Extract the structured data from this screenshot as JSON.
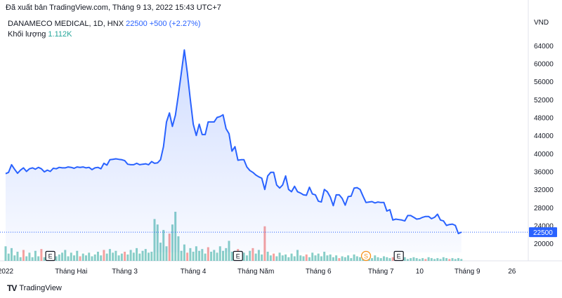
{
  "header": {
    "published": "Đã xuất bản TradingView.com, Tháng 9 13, 2022 15:43 UTC+7"
  },
  "legend": {
    "symbol": "DANAMECO MEDICAL, 1D, HNX",
    "price": "22500",
    "change": "+500 (+2.27%)",
    "volume_label": "Khối lượng",
    "volume_value": "1.112K"
  },
  "footer": {
    "brand": "TradingView",
    "logo": "TV"
  },
  "colors": {
    "line": "#2962ff",
    "fill": "#2962ff",
    "vol_up": "#26a69a",
    "vol_down": "#ef5350"
  },
  "chart_data": {
    "type": "area",
    "unit": "VND",
    "ylim": [
      18000,
      66000
    ],
    "yticks": [
      20000,
      24000,
      28000,
      32000,
      36000,
      40000,
      44000,
      48000,
      52000,
      56000,
      60000,
      64000
    ],
    "last_price": 22500,
    "xlim": [
      0,
      168
    ],
    "xticks": [
      {
        "x": 0,
        "label": "2022"
      },
      {
        "x": 22,
        "label": "Tháng Hai"
      },
      {
        "x": 40,
        "label": "Tháng 3"
      },
      {
        "x": 63,
        "label": "Tháng 4"
      },
      {
        "x": 84,
        "label": "Tháng Năm"
      },
      {
        "x": 105,
        "label": "Tháng 6"
      },
      {
        "x": 126,
        "label": "Tháng 7"
      },
      {
        "x": 139,
        "label": "10"
      },
      {
        "x": 155,
        "label": "Tháng 9"
      },
      {
        "x": 170,
        "label": "26"
      }
    ],
    "events": [
      {
        "x": 15,
        "label": "E"
      },
      {
        "x": 78,
        "label": "E"
      },
      {
        "x": 121,
        "label": "S"
      },
      {
        "x": 132,
        "label": "E"
      }
    ],
    "series": [
      {
        "values": [
          [
            0,
            35500
          ],
          [
            1,
            35800
          ],
          [
            2,
            37500
          ],
          [
            3,
            36500
          ],
          [
            4,
            35600
          ],
          [
            5,
            36300
          ],
          [
            6,
            36800
          ],
          [
            7,
            36000
          ],
          [
            8,
            36600
          ],
          [
            9,
            36800
          ],
          [
            10,
            36500
          ],
          [
            11,
            36900
          ],
          [
            12,
            36600
          ],
          [
            13,
            35900
          ],
          [
            14,
            36300
          ],
          [
            15,
            36000
          ],
          [
            16,
            36700
          ],
          [
            17,
            36600
          ],
          [
            18,
            36900
          ],
          [
            19,
            36800
          ],
          [
            20,
            36800
          ],
          [
            21,
            37000
          ],
          [
            22,
            36900
          ],
          [
            23,
            36700
          ],
          [
            24,
            37000
          ],
          [
            25,
            36900
          ],
          [
            26,
            37000
          ],
          [
            27,
            36800
          ],
          [
            28,
            36900
          ],
          [
            29,
            36400
          ],
          [
            30,
            36800
          ],
          [
            31,
            36900
          ],
          [
            32,
            36600
          ],
          [
            33,
            37800
          ],
          [
            34,
            37400
          ],
          [
            35,
            38600
          ],
          [
            36,
            38700
          ],
          [
            37,
            38800
          ],
          [
            38,
            38700
          ],
          [
            39,
            38600
          ],
          [
            40,
            38400
          ],
          [
            41,
            37600
          ],
          [
            42,
            37500
          ],
          [
            43,
            37500
          ],
          [
            44,
            37800
          ],
          [
            45,
            37500
          ],
          [
            46,
            37600
          ],
          [
            47,
            37700
          ],
          [
            48,
            37500
          ],
          [
            49,
            38200
          ],
          [
            50,
            37800
          ],
          [
            51,
            37900
          ],
          [
            52,
            38600
          ],
          [
            53,
            41500
          ],
          [
            54,
            47000
          ],
          [
            55,
            49000
          ],
          [
            56,
            46000
          ],
          [
            57,
            48500
          ],
          [
            58,
            53000
          ],
          [
            59,
            58000
          ],
          [
            60,
            63000
          ],
          [
            61,
            58000
          ],
          [
            62,
            52000
          ],
          [
            63,
            46500
          ],
          [
            64,
            44000
          ],
          [
            65,
            46500
          ],
          [
            66,
            44200
          ],
          [
            67,
            44200
          ],
          [
            68,
            47000
          ],
          [
            69,
            47000
          ],
          [
            70,
            47000
          ],
          [
            71,
            48000
          ],
          [
            72,
            48200
          ],
          [
            73,
            48600
          ],
          [
            74,
            45500
          ],
          [
            75,
            44400
          ],
          [
            76,
            40500
          ],
          [
            77,
            41500
          ],
          [
            78,
            38500
          ],
          [
            79,
            38600
          ],
          [
            80,
            38600
          ],
          [
            81,
            37000
          ],
          [
            82,
            36200
          ],
          [
            83,
            35800
          ],
          [
            84,
            35200
          ],
          [
            85,
            34800
          ],
          [
            86,
            34500
          ],
          [
            87,
            32000
          ],
          [
            88,
            35000
          ],
          [
            89,
            35800
          ],
          [
            90,
            35800
          ],
          [
            91,
            33000
          ],
          [
            92,
            32300
          ],
          [
            93,
            33000
          ],
          [
            94,
            35000
          ],
          [
            95,
            32000
          ],
          [
            96,
            31500
          ],
          [
            97,
            32700
          ],
          [
            98,
            31500
          ],
          [
            99,
            31200
          ],
          [
            100,
            30800
          ],
          [
            101,
            30700
          ],
          [
            102,
            32500
          ],
          [
            103,
            31000
          ],
          [
            104,
            30800
          ],
          [
            105,
            29400
          ],
          [
            106,
            29200
          ],
          [
            107,
            32000
          ],
          [
            108,
            31500
          ],
          [
            109,
            30300
          ],
          [
            110,
            28400
          ],
          [
            111,
            30800
          ],
          [
            112,
            30800
          ],
          [
            113,
            30000
          ],
          [
            114,
            28500
          ],
          [
            115,
            30400
          ],
          [
            116,
            30500
          ],
          [
            117,
            32300
          ],
          [
            118,
            32400
          ],
          [
            119,
            32000
          ],
          [
            120,
            30500
          ],
          [
            121,
            29100
          ],
          [
            122,
            29200
          ],
          [
            123,
            29300
          ],
          [
            124,
            29000
          ],
          [
            125,
            29200
          ],
          [
            126,
            29100
          ],
          [
            127,
            29100
          ],
          [
            128,
            27200
          ],
          [
            129,
            27500
          ],
          [
            130,
            25200
          ],
          [
            131,
            25400
          ],
          [
            132,
            25300
          ],
          [
            133,
            25200
          ],
          [
            134,
            25000
          ],
          [
            135,
            26200
          ],
          [
            136,
            26200
          ],
          [
            137,
            25800
          ],
          [
            138,
            25400
          ],
          [
            139,
            25500
          ],
          [
            140,
            25800
          ],
          [
            141,
            26000
          ],
          [
            142,
            26000
          ],
          [
            143,
            25500
          ],
          [
            144,
            25800
          ],
          [
            145,
            26500
          ],
          [
            146,
            25200
          ],
          [
            147,
            25000
          ],
          [
            148,
            24000
          ],
          [
            149,
            24200
          ],
          [
            150,
            24300
          ],
          [
            151,
            24000
          ],
          [
            152,
            22200
          ],
          [
            153,
            22500
          ]
        ]
      }
    ],
    "volume": [
      16,
      8,
      14,
      6,
      10,
      4,
      12,
      5,
      9,
      4,
      11,
      5,
      13,
      4,
      8,
      6,
      10,
      5,
      7,
      9,
      12,
      5,
      9,
      6,
      11,
      5,
      8,
      6,
      9,
      5,
      7,
      10,
      6,
      12,
      8,
      13,
      9,
      11,
      6,
      8,
      10,
      7,
      12,
      9,
      14,
      8,
      11,
      13,
      9,
      10,
      46,
      40,
      20,
      34,
      16,
      30,
      40,
      54,
      27,
      11,
      18,
      9,
      14,
      10,
      16,
      11,
      13,
      8,
      15,
      10,
      12,
      9,
      16,
      11,
      14,
      22,
      10,
      8,
      13,
      7,
      9,
      6,
      11,
      14,
      8,
      12,
      7,
      38,
      10,
      6,
      8,
      5,
      9,
      6,
      7,
      4,
      8,
      5,
      12,
      6,
      5,
      7,
      4,
      9,
      6,
      8,
      5,
      10,
      6,
      7,
      4,
      6,
      3,
      5,
      4,
      6,
      3,
      7,
      5,
      4,
      3,
      5,
      4,
      3,
      6,
      4,
      3,
      5,
      4,
      3,
      4,
      3,
      5,
      3,
      4,
      2,
      3,
      4,
      3,
      2,
      3,
      2,
      4,
      3,
      2,
      3,
      2,
      4,
      3,
      2,
      3,
      2,
      3,
      2
    ],
    "volume_down_indices": [
      6,
      12,
      25,
      33,
      40,
      55,
      61,
      68,
      78,
      83,
      87,
      90,
      101,
      112,
      121,
      130,
      141,
      149
    ]
  }
}
